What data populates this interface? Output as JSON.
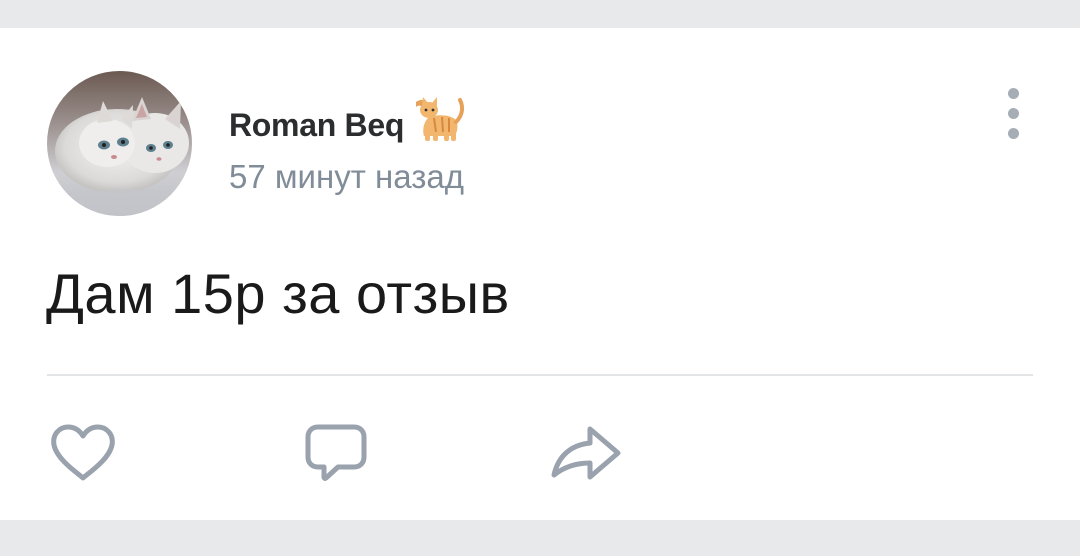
{
  "post": {
    "author": "Roman Beq",
    "author_emoji": "🐈",
    "timestamp": "57 минут назад",
    "text": "Дам 15р за отзыв"
  },
  "icons": {
    "avatar": "cat-photo-avatar",
    "more": "more-vertical-icon",
    "like": "heart-icon",
    "comment": "comment-icon",
    "share": "share-icon"
  },
  "colors": {
    "background": "#e8e9eb",
    "card": "#ffffff",
    "author": "#2c2d2e",
    "secondary_text": "#818c99",
    "icon": "#99a2ad",
    "divider": "#e3e4e6"
  }
}
